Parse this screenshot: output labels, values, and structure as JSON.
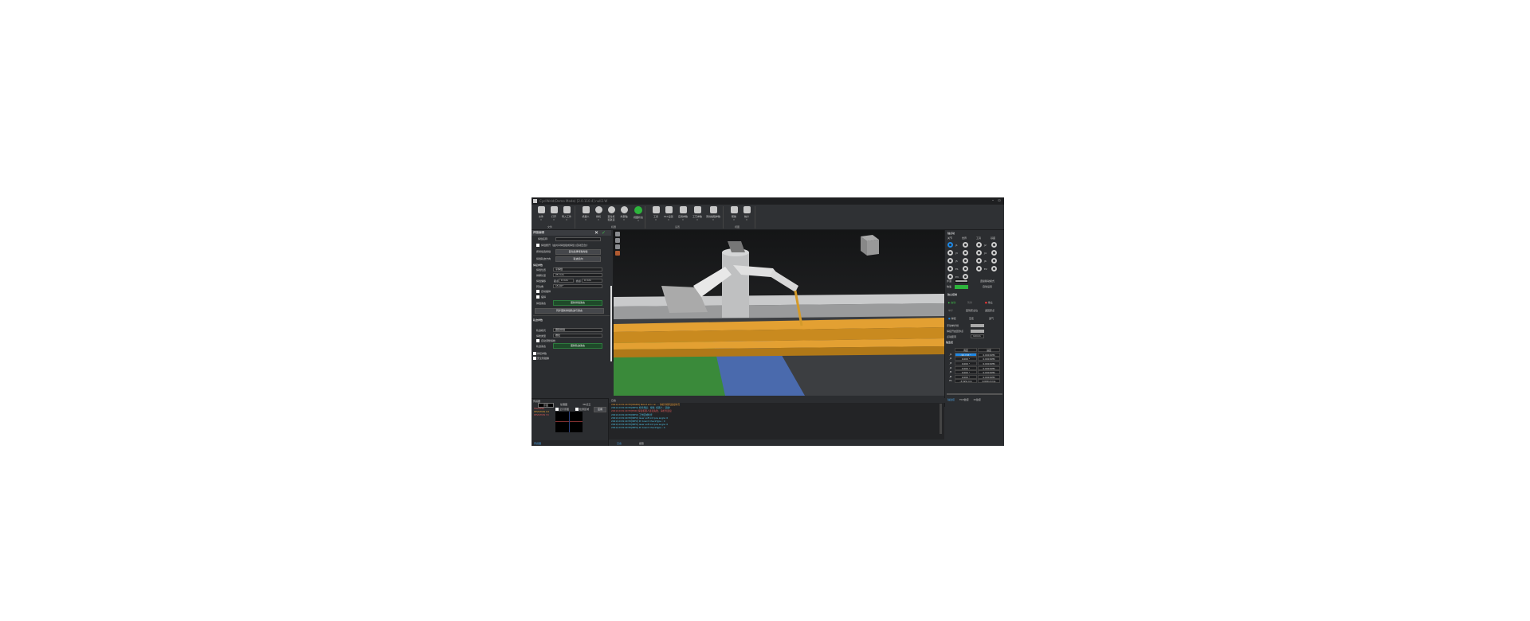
{
  "title": "CyclWeld(Demo Mode) [2.0.110.4] null2.W",
  "window_controls": {
    "minimize": "–",
    "maximize": "▫"
  },
  "ribbon": {
    "groups": [
      {
        "label": "文件"
      },
      {
        "label": "机器"
      },
      {
        "label": "设置"
      },
      {
        "label": "视图"
      }
    ],
    "buttons": [
      {
        "label": "文件",
        "icon": "folder-icon"
      },
      {
        "label": "打开",
        "icon": "folder-open-icon"
      },
      {
        "label": "导入工件",
        "icon": "import-icon"
      },
      {
        "label": "机器人",
        "icon": "robot-icon"
      },
      {
        "label": "焊机",
        "icon": "welder-icon"
      },
      {
        "label": "变位机",
        "sub": "和轨道",
        "icon": "positioner-icon"
      },
      {
        "label": "外部轴",
        "icon": "axis-icon"
      },
      {
        "label": "视图状态",
        "icon": "status-green-icon"
      },
      {
        "label": "工具",
        "icon": "toolbox-icon"
      },
      {
        "label": "PLC设置",
        "icon": "plc-icon"
      },
      {
        "label": "应用参数",
        "icon": "gear-icon"
      },
      {
        "label": "工艺参数",
        "icon": "process-icon"
      },
      {
        "label": "离线编程参数",
        "icon": "offline-icon"
      },
      {
        "label": "帮助",
        "icon": "help-icon"
      },
      {
        "label": "统计",
        "icon": "stats-icon"
      }
    ]
  },
  "left_panel": {
    "header": "焊缝编辑",
    "weld_name_label": "焊缝名称",
    "weld_name_value": "",
    "continuous_check": "焊缝断开（由共享焊缝组成焊缝 [自动压合]）",
    "adjust_label": "按焊缝选焊缝",
    "adjust_button": "自动选择特殊焊缝",
    "direction_label": "焊缝轨迹方向",
    "direction_button": "轨迹反向",
    "params_header": "焊接参数",
    "weld_type_label": "焊缝位置",
    "weld_type_value": "平焊缝",
    "leg_label": "焊脚长度",
    "leg_value": "25 mm",
    "offset_label": "焊缝偏移",
    "offset_start_label": "起点",
    "offset_start_value": "0 mm",
    "offset_end_label": "终点",
    "offset_end_value": "0 mm",
    "angle_label": "转位角",
    "angle_value": "15.00°",
    "auto_check": "自动摆焊",
    "swing_check": "摆焊",
    "update_label": "焊缝姿态",
    "update_button": "更新焊缝姿态",
    "sync_button": "同步更新焊缝轨迹与姿态",
    "track_header": "轨迹参数",
    "track_mode_label": "轨迹模式",
    "track_mode_value": "跟踪焊缝",
    "torch_label": "焊枪类型",
    "torch_value": "推拉",
    "auto_adjust_check": "自动调整焊枪",
    "track_update_label": "轨迹姿态",
    "track_update_button": "更新轨迹姿态",
    "collapsed_1": "焊接参数",
    "collapsed_2": "安全防碰撞"
  },
  "bottom_left": {
    "header": "传感器",
    "tabs": [
      "原图",
      "处理图",
      "3D点云"
    ],
    "check_1": "显示原图",
    "check_2": "检测区域",
    "apply": "应用",
    "readouts": [
      "TRACKING",
      "DEVIATION X:0",
      "DEVIATION Y:0"
    ],
    "footer_tab": "传感器"
  },
  "log": {
    "header": "日志",
    "lines": [
      {
        "text": "2021/10 09:40:55[WARN] Robot sim run ... 请检查相机连接情况",
        "color": "#e39a3a"
      },
      {
        "text": "2021/10 09:40:55[INFO] 检查焊接：焊缝, 机器人：就绪!",
        "color": "#4fc3e6"
      },
      {
        "text": "2021/10 09:40:55[ERR] 焊接机器人连接失败，请检查连接",
        "color": "#e05a5a"
      },
      {
        "text": "2021/10 09:40:55[INFO] 工作区域检查",
        "color": "#4fc3e6"
      },
      {
        "text": "2021/10 09:40:55[INFO] laser soft init pos angle: 0",
        "color": "#4fc3e6"
      },
      {
        "text": "2021/10 09:40:55[INFO] Pc board CheckType : 0",
        "color": "#4fc3e6"
      },
      {
        "text": "2021/10 09:40:55[INFO] laser soft init pos angle: 0",
        "color": "#4fc3e6"
      },
      {
        "text": "2021/10 09:40:55[INFO] Pc board CheckType : 0",
        "color": "#4fc3e6"
      }
    ],
    "tabs": [
      "日志",
      "报警"
    ]
  },
  "right_panel": {
    "jog_header": "轴点动",
    "frames": [
      "关节",
      "世界",
      "工具",
      "基座"
    ],
    "joints": [
      "J1",
      "J2",
      "J3",
      "J4",
      "J5",
      "J6",
      "E1",
      "E2",
      "E3"
    ],
    "step_label": "步进",
    "speed_label": "快速",
    "continuous": "连续移动模式",
    "auto_label": "自动设置",
    "control_header": "独立控制",
    "start": "启动",
    "pause": "暂停",
    "stop": "停止",
    "step": "单步",
    "return": "回到安全位",
    "return2": "返回原点",
    "weld": "焊接",
    "dry": "空走",
    "air": "送气",
    "toggle_1": "手动单步焊",
    "toggle_2": "焊接开启回零点",
    "step_dist_label": "点动距离",
    "step_dist_value": "10mm",
    "monitor_header": "轴监控",
    "monitor_cols": [
      "角度",
      "速度"
    ],
    "monitor_rows": [
      {
        "j": "J1",
        "a": "-96.728 °",
        "v": "0.000 RPM"
      },
      {
        "j": "J2",
        "a": "0.000 °",
        "v": "0.000 RPM"
      },
      {
        "j": "J3",
        "a": "0.000 °",
        "v": "0.000 RPM"
      },
      {
        "j": "J4",
        "a": "0.000 °",
        "v": "0.000 RPM"
      },
      {
        "j": "J5",
        "a": "0.000 °",
        "v": "0.000 RPM"
      },
      {
        "j": "J6",
        "a": "0.000 °",
        "v": "0.000 RPM"
      },
      {
        "j": "E1",
        "a": "-3.529 mm",
        "v": "0.000 mm/s"
      }
    ],
    "tabs": [
      "轴监控",
      "TCP监控",
      "IO监控"
    ]
  },
  "colors": {
    "accent": "#1e88e5",
    "green": "#2db43c",
    "beam": "#d08f1e",
    "floor_blue": "#4466aa"
  }
}
